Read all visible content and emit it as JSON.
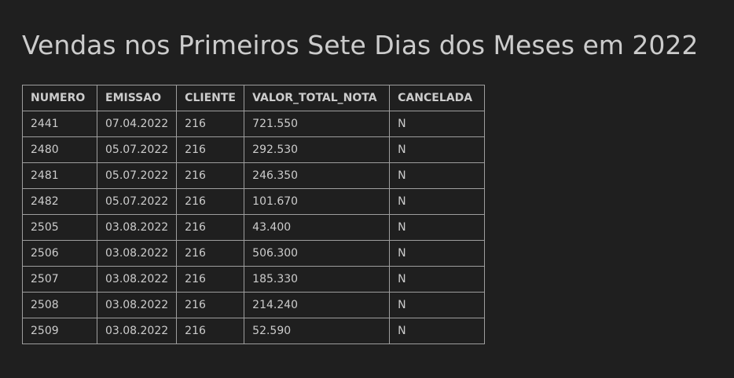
{
  "page": {
    "title": "Vendas nos Primeiros Sete Dias dos Meses em 2022"
  },
  "table": {
    "columns": [
      "NUMERO",
      "EMISSAO",
      "CLIENTE",
      "VALOR_TOTAL_NOTA",
      "CANCELADA"
    ],
    "rows": [
      [
        "2441",
        "07.04.2022",
        "216",
        "721.550",
        "N"
      ],
      [
        "2480",
        "05.07.2022",
        "216",
        "292.530",
        "N"
      ],
      [
        "2481",
        "05.07.2022",
        "216",
        "246.350",
        "N"
      ],
      [
        "2482",
        "05.07.2022",
        "216",
        "101.670",
        "N"
      ],
      [
        "2505",
        "03.08.2022",
        "216",
        "43.400",
        "N"
      ],
      [
        "2506",
        "03.08.2022",
        "216",
        "506.300",
        "N"
      ],
      [
        "2507",
        "03.08.2022",
        "216",
        "185.330",
        "N"
      ],
      [
        "2508",
        "03.08.2022",
        "216",
        "214.240",
        "N"
      ],
      [
        "2509",
        "03.08.2022",
        "216",
        "52.590",
        "N"
      ]
    ]
  },
  "colors": {
    "background": "#1f1f1f",
    "text": "#cccccc",
    "border": "#9e9e9e"
  }
}
